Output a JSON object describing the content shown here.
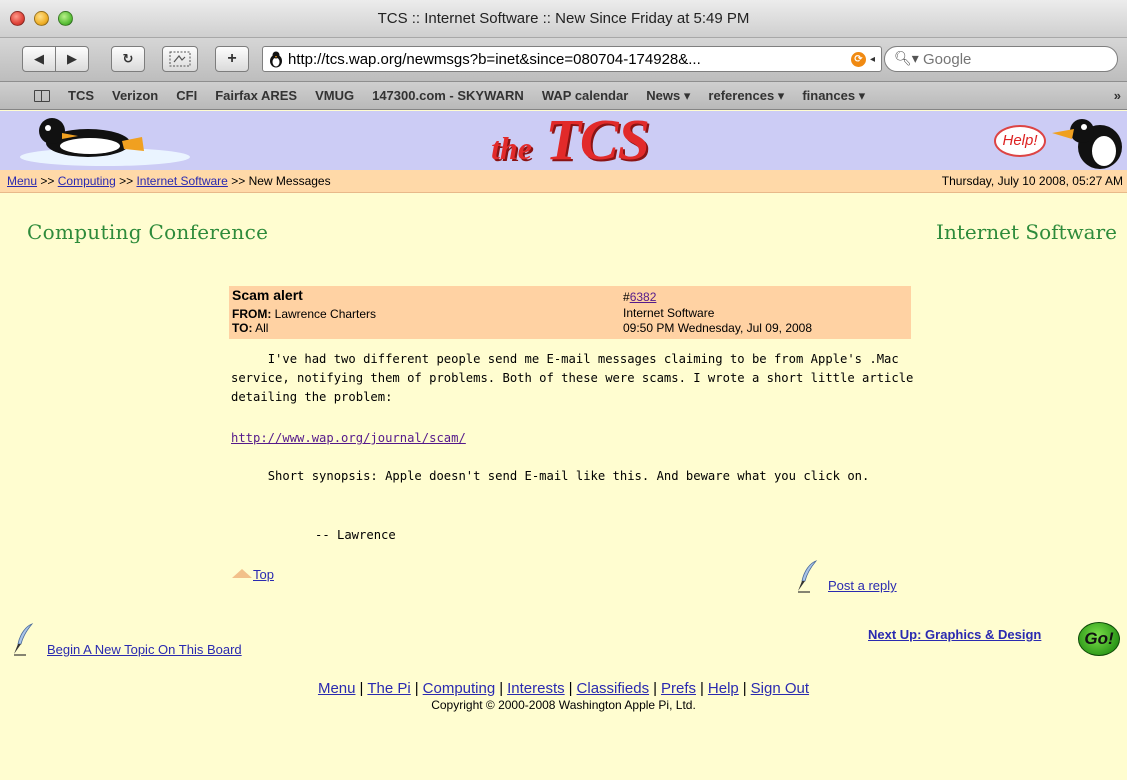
{
  "window": {
    "title": "TCS :: Internet Software :: New Since Friday at 5:49 PM"
  },
  "toolbar": {
    "back_icon": "back-arrow-icon",
    "forward_icon": "forward-arrow-icon",
    "address": "http://tcs.wap.org/newmsgs?b=inet&since=080704-174928&...",
    "search_placeholder": "Google"
  },
  "bookmarks": [
    "TCS",
    "Verizon",
    "CFI",
    "Fairfax ARES",
    "VMUG",
    "147300.com - SKYWARN",
    "WAP calendar",
    "News ▾",
    "references ▾",
    "finances ▾"
  ],
  "bookmarks_more": "»",
  "header": {
    "logo_the": "the",
    "logo_tcs": "TCS",
    "help": "Help!",
    "breadcrumb": {
      "menu": "Menu",
      "sep": ">>",
      "computing": "Computing",
      "board": "Internet Software",
      "current": "New Messages"
    },
    "datetime": "Thursday, July 10 2008, 05:27 AM"
  },
  "page": {
    "conference_title": "Computing Conference",
    "board_title": "Internet Software"
  },
  "message": {
    "subject": "Scam alert",
    "from_label": "FROM:",
    "from": "Lawrence Charters",
    "to_label": "TO:",
    "to": "All",
    "number_prefix": "#",
    "number": "6382",
    "board": "Internet Software",
    "date": "09:50 PM Wednesday, Jul 09, 2008",
    "body_p1": "     I've had two different people send me E-mail messages claiming to be from Apple's .Mac service, notifying them of problems. Both of these were scams. I wrote a short little article detailing the problem:",
    "link": "http://www.wap.org/journal/scam/",
    "body_p2": "     Short synopsis: Apple doesn't send E-mail like this. And beware what you click on.",
    "signature": "-- Lawrence"
  },
  "actions": {
    "top": "Top",
    "post_reply": "Post a reply",
    "new_topic": "Begin A New Topic On This Board",
    "next_up": "Next Up: Graphics & Design",
    "go": "Go!"
  },
  "footer": {
    "links": [
      "Menu",
      "The Pi",
      "Computing",
      "Interests",
      "Classifieds",
      "Prefs",
      "Help",
      "Sign Out"
    ],
    "copyright": "Copyright © 2000-2008 Washington Apple Pi, Ltd."
  }
}
